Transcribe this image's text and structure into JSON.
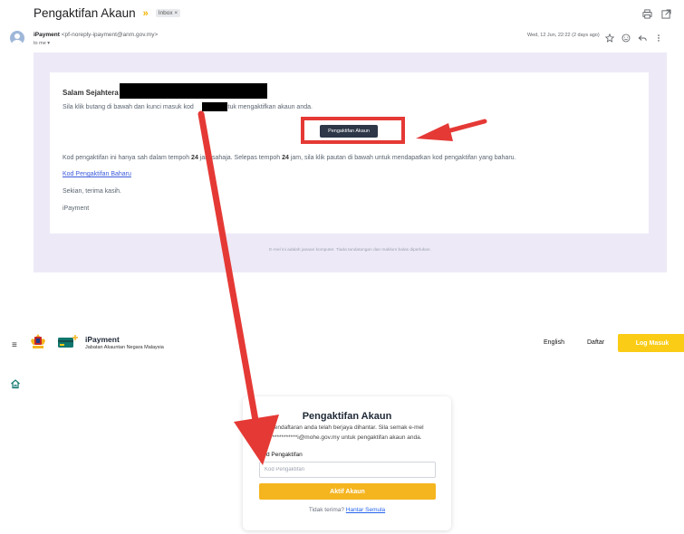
{
  "gmail": {
    "subject": "Pengaktifan Akaun",
    "inbox_chip": "Inbox ×",
    "sender_name": "iPayment",
    "sender_email": "<pf-noreply-ipayment@anm.gov.my>",
    "to_line": "to me ▾",
    "date": "Wed, 12 Jun, 22:22 (2 days ago)",
    "icons": {
      "print": "print-icon",
      "open": "open-in-new-icon",
      "star": "star-icon",
      "emoji": "emoji-icon",
      "reply": "reply-icon",
      "more": "more-vert-icon"
    }
  },
  "email": {
    "greeting": "Salam Sejahtera",
    "instruction_before": "Sila klik butang di bawah dan kunci masuk kod",
    "instruction_after": "untuk mengaktifkan akaun anda.",
    "button_label": "Pengaktifan Akaun",
    "validity_1": "Kod pengaktifan ini hanya sah dalam tempoh ",
    "validity_bold_1": "24",
    "validity_2": " jam sahaja. Selepas tempoh ",
    "validity_bold_2": "24",
    "validity_3": " jam, sila klik pautan di bawah untuk mendapatkan kod pengaktifan yang baharu.",
    "new_code_link": "Kod Pengaktifan Baharu",
    "thanks": "Sekian, terima kasih.",
    "signoff": "iPayment",
    "footer": "E-mel ini adalah janaan komputer. Tiada tandatangan dan maklum balas diperlukan."
  },
  "site": {
    "brand_title": "iPayment",
    "brand_subtitle": "Jabatan Akauntan Negara Malaysia",
    "nav_english": "English",
    "nav_daftar": "Daftar",
    "login_label": "Log Masuk",
    "hamburger_icon": "hamburger-icon",
    "home_icon": "home-icon"
  },
  "activation": {
    "title": "Pengaktifan Akaun",
    "message_line1": "Pendaftaran anda telah berjaya dihantar. Sila semak e-mel",
    "message_line2": "***********i@mohe.gov.my untuk pengaktifan akaun anda.",
    "field_label": "Kod Pengaktifan",
    "field_placeholder": "Kod Pengaktifan",
    "field_value": "",
    "submit_label": "Aktif Akaun",
    "resend_prompt": "Tidak terima?",
    "resend_link": "Hantar Semula"
  },
  "colors": {
    "annotation_red": "#e53935",
    "email_bg": "#ede9f7",
    "accent_yellow": "#facc15",
    "email_button": "#2d3748"
  }
}
